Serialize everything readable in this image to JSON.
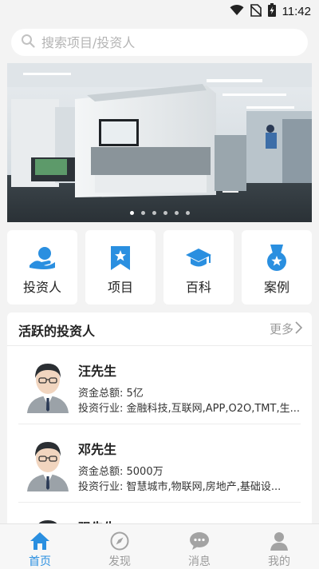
{
  "status_bar": {
    "time": "11:42"
  },
  "search": {
    "placeholder": "搜索项目/投资人"
  },
  "banner": {
    "slide_count": 6,
    "active_index": 0
  },
  "categories": [
    {
      "label": "投资人",
      "icon": "investor-icon"
    },
    {
      "label": "项目",
      "icon": "bookmark-star-icon"
    },
    {
      "label": "百科",
      "icon": "graduation-cap-icon"
    },
    {
      "label": "案例",
      "icon": "medal-icon"
    }
  ],
  "investors_section": {
    "title": "活跃的投资人",
    "more_label": "更多",
    "items": [
      {
        "name": "汪先生",
        "funds": "资金总额: 5亿",
        "industry": "投资行业: 金融科技,互联网,APP,O2O,TMT,生..."
      },
      {
        "name": "邓先生",
        "funds": "资金总额: 5000万",
        "industry": "投资行业: 智慧城市,物联网,房地产,基础设..."
      },
      {
        "name": "强先生",
        "funds": "",
        "industry": ""
      }
    ]
  },
  "tabbar": {
    "tabs": [
      {
        "label": "首页",
        "icon": "home-icon",
        "active": true
      },
      {
        "label": "发现",
        "icon": "compass-icon",
        "active": false
      },
      {
        "label": "消息",
        "icon": "chat-bubble-icon",
        "active": false
      },
      {
        "label": "我的",
        "icon": "user-icon",
        "active": false
      }
    ]
  },
  "colors": {
    "accent": "#2a8fe0",
    "inactive": "#9b9b9b",
    "background": "#f3f3f3"
  }
}
